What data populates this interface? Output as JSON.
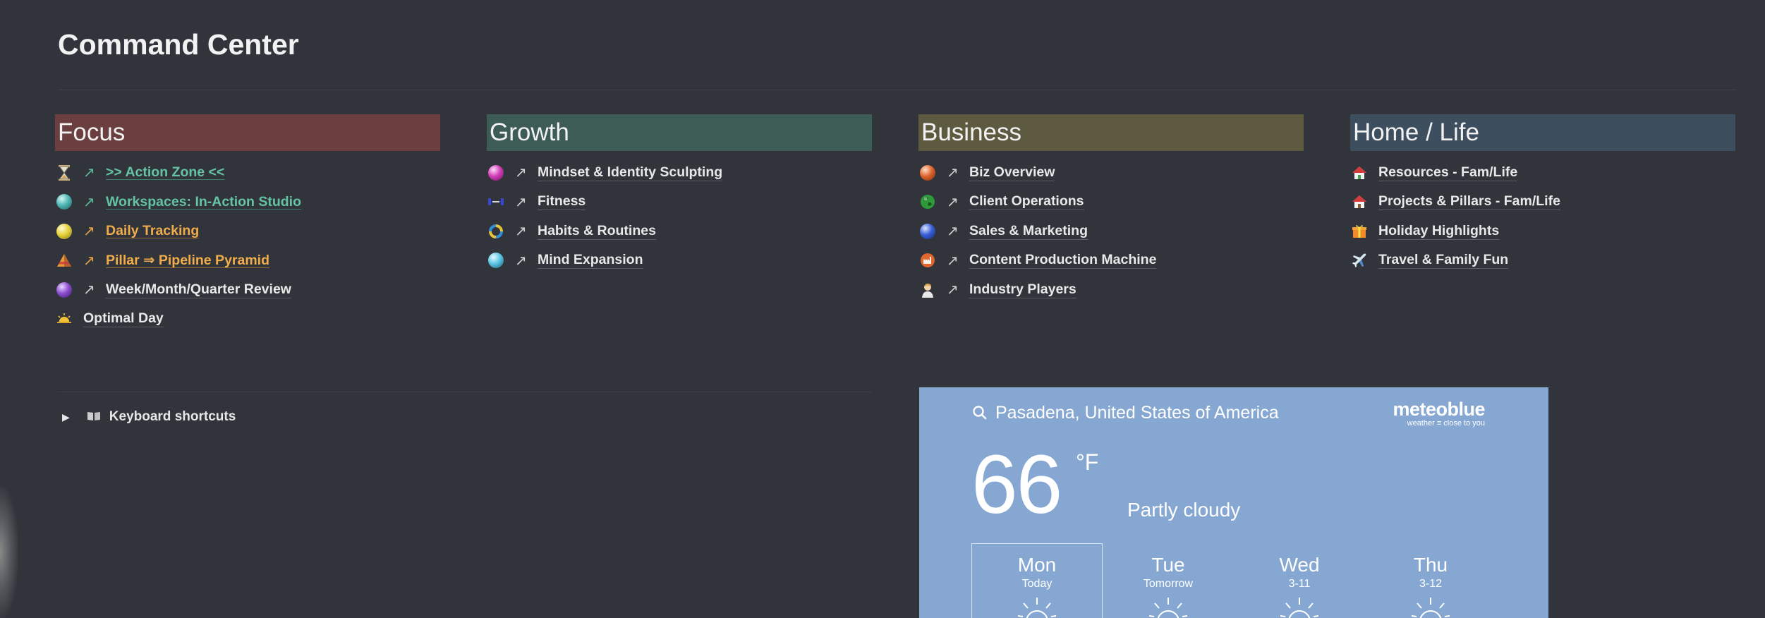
{
  "page": {
    "title": "Command Center"
  },
  "columns": [
    {
      "header": "Focus",
      "header_color": "#6b3f3f",
      "items": [
        {
          "label": ">> Action Zone <<",
          "icon": "hourglass-icon",
          "style": "teal",
          "arrow": "↗"
        },
        {
          "label": "Workspaces: In-Action Studio",
          "icon": "teal-orb-icon",
          "style": "teal",
          "arrow": "↗"
        },
        {
          "label": "Daily Tracking",
          "icon": "yellow-orb-icon",
          "style": "orange",
          "arrow": "↗"
        },
        {
          "label": "Pillar ⇒ Pipeline Pyramid",
          "icon": "pyramid-icon",
          "style": "orange",
          "arrow": "↗"
        },
        {
          "label": "Week/Month/Quarter Review",
          "icon": "purple-orb-icon",
          "style": "plain",
          "arrow": "↗"
        },
        {
          "label": "Optimal Day",
          "icon": "sunrise-icon",
          "style": "plain",
          "arrow": ""
        }
      ]
    },
    {
      "header": "Growth",
      "header_color": "#3e5c56",
      "items": [
        {
          "label": "Mindset & Identity Sculpting",
          "icon": "magenta-orb-icon",
          "style": "plain",
          "arrow": "↗"
        },
        {
          "label": "Fitness",
          "icon": "dumbbell-icon",
          "style": "plain",
          "arrow": "↗"
        },
        {
          "label": "Habits & Routines",
          "icon": "ring-icon",
          "style": "plain",
          "arrow": "↗"
        },
        {
          "label": "Mind Expansion",
          "icon": "cyan-orb-icon",
          "style": "plain",
          "arrow": "↗"
        }
      ]
    },
    {
      "header": "Business",
      "header_color": "#5e5a40",
      "items": [
        {
          "label": "Biz Overview",
          "icon": "orange-orb-icon",
          "style": "plain",
          "arrow": "↗"
        },
        {
          "label": "Client Operations",
          "icon": "green-globe-icon",
          "style": "plain",
          "arrow": "↗"
        },
        {
          "label": "Sales & Marketing",
          "icon": "blue-orb-icon",
          "style": "plain",
          "arrow": "↗"
        },
        {
          "label": "Content Production Machine",
          "icon": "factory-icon",
          "style": "plain",
          "arrow": "↗"
        },
        {
          "label": "Industry Players",
          "icon": "person-icon",
          "style": "plain",
          "arrow": "↗"
        }
      ]
    },
    {
      "header": "Home / Life",
      "header_color": "#3d4e5e",
      "items": [
        {
          "label": "Resources - Fam/Life",
          "icon": "house-icon",
          "style": "plain",
          "arrow": ""
        },
        {
          "label": "Projects & Pillars - Fam/Life",
          "icon": "house-icon",
          "style": "plain",
          "arrow": ""
        },
        {
          "label": "Holiday Highlights",
          "icon": "gift-icon",
          "style": "plain",
          "arrow": ""
        },
        {
          "label": "Travel & Family Fun",
          "icon": "airplane-icon",
          "style": "plain",
          "arrow": ""
        }
      ]
    }
  ],
  "toggle": {
    "label": "Keyboard shortcuts",
    "icon": "book-icon"
  },
  "weather": {
    "location": "Pasadena, United States of America",
    "brand": "meteoblue",
    "brand_tagline": "weather ≡ close to you",
    "temperature": "66",
    "unit": "°F",
    "condition": "Partly cloudy",
    "days": [
      {
        "name": "Mon",
        "sub": "Today",
        "selected": true
      },
      {
        "name": "Tue",
        "sub": "Tomorrow",
        "selected": false
      },
      {
        "name": "Wed",
        "sub": "3-11",
        "selected": false
      },
      {
        "name": "Thu",
        "sub": "3-12",
        "selected": false
      }
    ]
  }
}
